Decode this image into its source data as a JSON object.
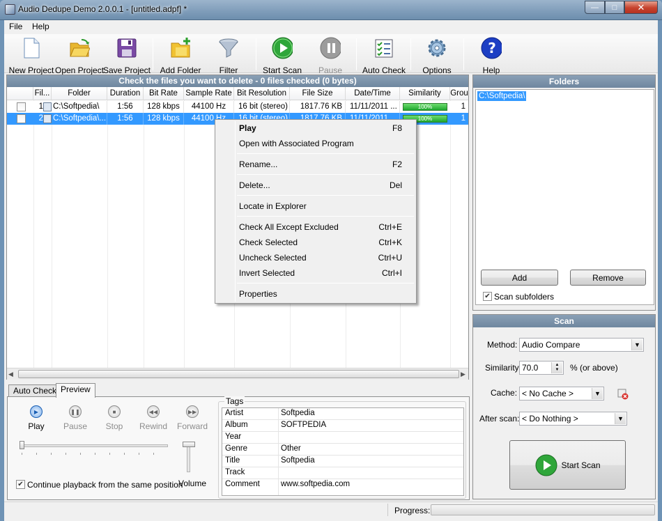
{
  "window": {
    "title": "Audio Dedupe Demo 2.0.0.1 - [untitled.adpf] *",
    "controls": {
      "minimize": "—",
      "maximize": "□",
      "close": "✕"
    }
  },
  "menu": {
    "items": [
      "File",
      "Help"
    ]
  },
  "toolbar": {
    "buttons": [
      {
        "label": "New Project",
        "icon": "new-document-icon"
      },
      {
        "label": "Open Project",
        "icon": "open-folder-icon"
      },
      {
        "label": "Save Project",
        "icon": "floppy-disk-icon"
      },
      {
        "label": "Add Folder",
        "icon": "add-folder-icon"
      },
      {
        "label": "Filter",
        "icon": "funnel-icon"
      },
      {
        "label": "Start Scan",
        "icon": "play-icon"
      },
      {
        "label": "Pause",
        "icon": "pause-icon",
        "disabled": true
      },
      {
        "label": "Auto Check",
        "icon": "checklist-icon"
      },
      {
        "label": "Options",
        "icon": "gear-icon"
      },
      {
        "label": "Help",
        "icon": "help-icon"
      }
    ]
  },
  "file_list": {
    "header": "Check the files you want to delete - 0 files checked (0 bytes)",
    "columns": [
      "Fil...",
      "Folder",
      "Duration",
      "Bit Rate",
      "Sample Rate",
      "Bit Resolution",
      "File Size",
      "Date/Time",
      "Similarity",
      "Grou"
    ],
    "rows": [
      {
        "num": "1",
        "folder": "C:\\Softpedia\\",
        "duration": "1:56",
        "bitrate": "128 kbps",
        "samplerate": "44100 Hz",
        "resolution": "16 bit (stereo)",
        "size": "1817.76 KB",
        "date": "11/11/2011 ...",
        "similarity": "100%",
        "similarity_value": 100,
        "group": "1",
        "selected": false
      },
      {
        "num": "2",
        "folder": "C:\\Softpedia\\...",
        "duration": "1:56",
        "bitrate": "128 kbps",
        "samplerate": "44100 Hz",
        "resolution": "16 bit (stereo)",
        "size": "1817.76 KB",
        "date": "11/11/2011",
        "similarity": "100%",
        "similarity_value": 100,
        "group": "1",
        "selected": true
      }
    ]
  },
  "context_menu": {
    "groups": [
      [
        {
          "label": "Play",
          "shortcut": "F8",
          "bold": true
        },
        {
          "label": "Open with Associated Program",
          "shortcut": ""
        }
      ],
      [
        {
          "label": "Rename...",
          "shortcut": "F2"
        }
      ],
      [
        {
          "label": "Delete...",
          "shortcut": "Del"
        }
      ],
      [
        {
          "label": "Locate in Explorer",
          "shortcut": ""
        }
      ],
      [
        {
          "label": "Check All Except Excluded",
          "shortcut": "Ctrl+E"
        },
        {
          "label": "Check Selected",
          "shortcut": "Ctrl+K"
        },
        {
          "label": "Uncheck Selected",
          "shortcut": "Ctrl+U"
        },
        {
          "label": "Invert Selected",
          "shortcut": "Ctrl+I"
        }
      ],
      [
        {
          "label": "Properties",
          "shortcut": ""
        }
      ]
    ]
  },
  "folders": {
    "title": "Folders",
    "items": [
      "C:\\Softpedia\\"
    ],
    "add_label": "Add",
    "remove_label": "Remove",
    "scan_subfolders_label": "Scan subfolders",
    "scan_subfolders_checked": true
  },
  "scan": {
    "title": "Scan",
    "method_label": "Method:",
    "method_value": "Audio Compare",
    "similarity_label": "Similarity:",
    "similarity_value": "70.0",
    "similarity_suffix": "% (or above)",
    "cache_label": "Cache:",
    "cache_value": "< No Cache >",
    "after_label": "After scan:",
    "after_value": "< Do Nothing >",
    "start_label": "Start Scan"
  },
  "preview": {
    "tabs": [
      "Auto Check",
      "Preview"
    ],
    "active_tab": "Preview",
    "controls": [
      {
        "label": "Play",
        "icon": "play-icon",
        "enabled": true
      },
      {
        "label": "Pause",
        "icon": "pause-icon",
        "enabled": false
      },
      {
        "label": "Stop",
        "icon": "stop-icon",
        "enabled": false
      },
      {
        "label": "Rewind",
        "icon": "rewind-icon",
        "enabled": false
      },
      {
        "label": "Forward",
        "icon": "forward-icon",
        "enabled": false
      }
    ],
    "continue_label": "Continue playback from the same position",
    "continue_checked": true,
    "volume_label": "Volume",
    "tags_title": "Tags",
    "tags": [
      {
        "key": "Artist",
        "value": "Softpedia"
      },
      {
        "key": "Album",
        "value": "SOFTPEDIA"
      },
      {
        "key": "Year",
        "value": ""
      },
      {
        "key": "Genre",
        "value": "Other"
      },
      {
        "key": "Title",
        "value": "Softpedia"
      },
      {
        "key": "Track",
        "value": ""
      },
      {
        "key": "Comment",
        "value": "www.softpedia.com"
      }
    ]
  },
  "status": {
    "progress_label": "Progress:"
  },
  "colors": {
    "header_blue": "#7d94ac",
    "selection": "#3399ff",
    "similarity_green": "#1fa82f"
  }
}
